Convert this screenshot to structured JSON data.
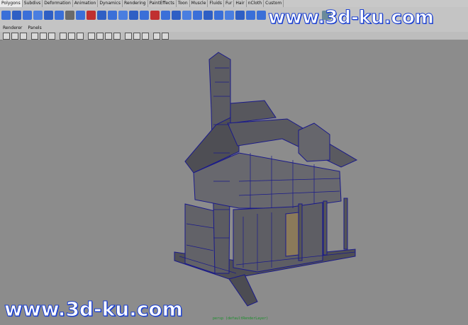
{
  "shelf_tabs": [
    "Polygons",
    "Subdivs",
    "Deformation",
    "Animation",
    "Dynamics",
    "Rendering",
    "PaintEffects",
    "Toon",
    "Muscle",
    "Fluids",
    "Fur",
    "Hair",
    "nCloth",
    "Custom"
  ],
  "panel_menu": [
    "Renderer",
    "Panels"
  ],
  "watermark_top": "www.3d-ku.com",
  "watermark_bottom": "www.3d-ku.com",
  "camera_label": "persp (defaultRenderLayer)",
  "colors": {
    "ui_bg": "#c4c4c4",
    "viewport_bg": "#8c8c8c",
    "wireframe": "#1a1a8a",
    "watermark_stroke": "#1a3fd1"
  }
}
